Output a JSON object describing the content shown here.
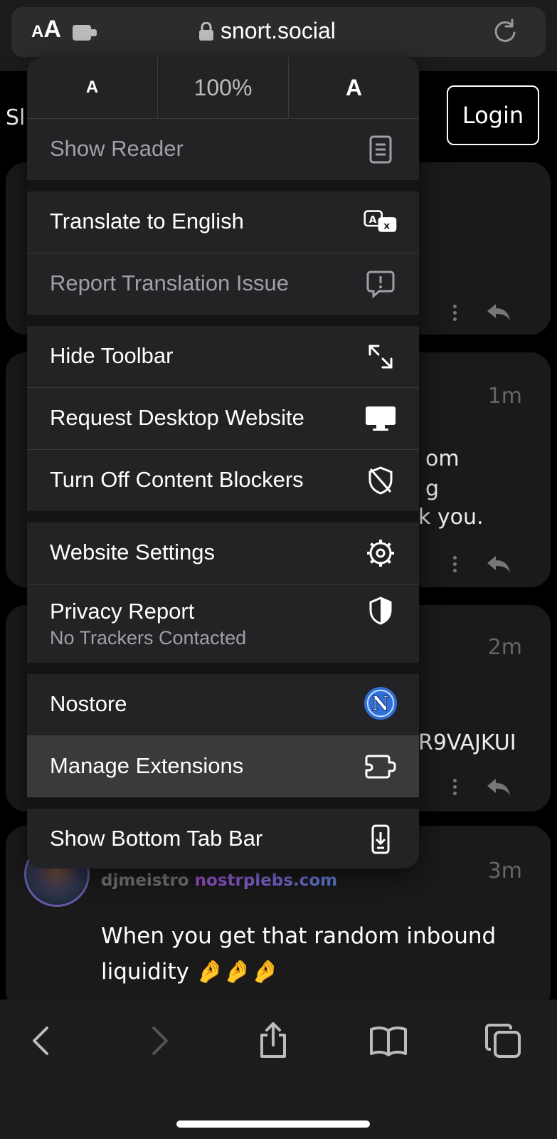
{
  "browser": {
    "aa_label_small": "A",
    "aa_label_large": "A",
    "url": "snort.social"
  },
  "page": {
    "title_stub": "Sl",
    "login_label": "Login",
    "cards": [
      {
        "time": "",
        "fragments": []
      },
      {
        "time": "1m",
        "fragments": [
          "om",
          "g",
          "k you."
        ]
      },
      {
        "time": "2m",
        "fragments": [
          "R9VAJKUI"
        ]
      },
      {
        "time": "3m",
        "fragments": []
      }
    ],
    "post": {
      "username": "djmeistro",
      "domain": "nostrplebs.com",
      "body": "When you get that random inbound liquidity 🤌🤌🤌"
    }
  },
  "menu": {
    "zoom": {
      "smaller": "A",
      "value": "100%",
      "larger": "A"
    },
    "items": [
      {
        "label": "Show Reader",
        "icon": "reader-icon"
      },
      {
        "label": "Translate to English",
        "icon": "translate-icon"
      },
      {
        "label": "Report Translation Issue",
        "icon": "report-icon"
      },
      {
        "label": "Hide Toolbar",
        "icon": "expand-arrows-icon"
      },
      {
        "label": "Request Desktop Website",
        "icon": "desktop-icon"
      },
      {
        "label": "Turn Off Content Blockers",
        "icon": "shield-slash-icon"
      },
      {
        "label": "Website Settings",
        "icon": "gear-icon"
      },
      {
        "label": "Privacy Report",
        "sublabel": "No Trackers Contacted",
        "icon": "privacy-shield-icon"
      },
      {
        "label": "Nostore",
        "icon": "nostore-logo-icon"
      },
      {
        "label": "Manage Extensions",
        "icon": "extension-icon"
      },
      {
        "label": "Show Bottom Tab Bar",
        "icon": "phone-down-icon"
      }
    ]
  },
  "colors": {
    "menu_bg": "#232325",
    "highlight": "#3a3a3c",
    "dim_text": "#a0a0a5",
    "nostore_blue": "#2f6fd8"
  }
}
